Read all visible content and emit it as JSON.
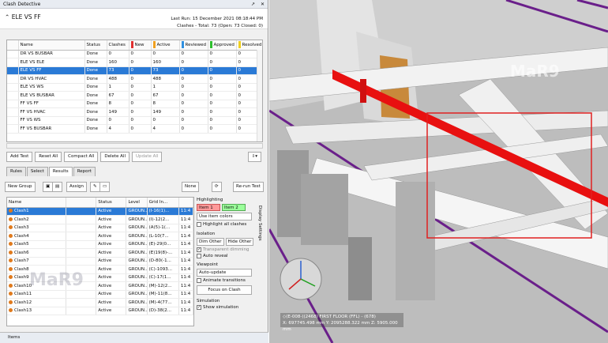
{
  "window": {
    "title": "Clash Detective",
    "buttons": [
      "↗",
      "✕"
    ]
  },
  "test_header": {
    "name": "ELE VS FF",
    "last_run": "Last Run:  15 December 2021 08:18:44 PM",
    "summary": "Clashes - Total: 73  (Open: 73  Closed: 0)"
  },
  "tests_table": {
    "headers": [
      "Name",
      "Status",
      "Clashes",
      "New",
      "Active",
      "Reviewed",
      "Approved",
      "Resolved"
    ],
    "header_colors": [
      "",
      "",
      "",
      "#e03030",
      "#f0a020",
      "#3090e0",
      "#30c030",
      "#f0d020"
    ],
    "rows": [
      [
        "DR VS BUSBAR",
        "Done",
        "0",
        "0",
        "0",
        "0",
        "0",
        "0"
      ],
      [
        "ELE VS ELE",
        "Done",
        "160",
        "0",
        "160",
        "0",
        "0",
        "0"
      ],
      [
        "ELE VS FF",
        "Done",
        "73",
        "0",
        "73",
        "0",
        "0",
        "0"
      ],
      [
        "DR VS HVAC",
        "Done",
        "488",
        "0",
        "488",
        "0",
        "0",
        "0"
      ],
      [
        "ELE VS WS",
        "Done",
        "1",
        "0",
        "1",
        "0",
        "0",
        "0"
      ],
      [
        "ELE VS BUSBAR",
        "Done",
        "67",
        "0",
        "67",
        "0",
        "0",
        "0"
      ],
      [
        "FF VS FF",
        "Done",
        "8",
        "0",
        "8",
        "0",
        "0",
        "0"
      ],
      [
        "FF VS HVAC",
        "Done",
        "149",
        "0",
        "149",
        "0",
        "0",
        "0"
      ],
      [
        "FF VS WS",
        "Done",
        "0",
        "0",
        "0",
        "0",
        "0",
        "0"
      ],
      [
        "FF VS BUSBAR",
        "Done",
        "4",
        "0",
        "4",
        "0",
        "0",
        "0"
      ]
    ],
    "selected_index": 2
  },
  "test_buttons": [
    "Add Test",
    "Reset All",
    "Compact All",
    "Delete All",
    "Update All"
  ],
  "tabs": [
    "Rules",
    "Select",
    "Results",
    "Report"
  ],
  "active_tab": 2,
  "results_toolbar": {
    "new_group": "New Group",
    "assign": "Assign",
    "none_label": "None",
    "rerun": "Re-run Test"
  },
  "results_table": {
    "headers": [
      "Name",
      "",
      "Status",
      "Level",
      "Grid In..."
    ],
    "rows": [
      [
        "Clash1",
        "Active",
        "GROUN...",
        "(I-16(1)...",
        "11:4"
      ],
      [
        "Clash2",
        "Active",
        "GROUN...",
        "(I)-12(2...",
        "11:4"
      ],
      [
        "Clash3",
        "Active",
        "GROUN...",
        "(A(5)-1(...",
        "11:4"
      ],
      [
        "Clash4",
        "Active",
        "GROUN...",
        "(L-10(7...",
        "11:4"
      ],
      [
        "Clash5",
        "Active",
        "GROUN...",
        "(E)-29(0...",
        "11:4"
      ],
      [
        "Clash6",
        "Active",
        "GROUN...",
        "(E)19(8)-...",
        "11:4"
      ],
      [
        "Clash7",
        "Active",
        "GROUN...",
        "(D-80(-1...",
        "11:4"
      ],
      [
        "Clash8",
        "Active",
        "GROUN...",
        "(C)-1093...",
        "11:4"
      ],
      [
        "Clash9",
        "Active",
        "GROUN...",
        "(C)-17(1...",
        "11:4"
      ],
      [
        "Clash10",
        "Active",
        "GROUN...",
        "(M)-12(2...",
        "11:4"
      ],
      [
        "Clash11",
        "Active",
        "GROUN...",
        "(M)-11(8...",
        "11:4"
      ],
      [
        "Clash12",
        "Active",
        "GROUN...",
        "(M)-4(77...",
        "11:4"
      ],
      [
        "Clash13",
        "Active",
        "GROUN...",
        "(D)-38(2...",
        "11:4"
      ]
    ],
    "selected_index": 0
  },
  "highlighting": {
    "title": "Highlighting",
    "item1": "Item 1",
    "item2": "Item 2",
    "use_item_colors": "Use item colors",
    "highlight_all": "Highlight all clashes",
    "isolation": "Isolation",
    "dim_other": "Dim Other",
    "hide_other": "Hide Other",
    "transparent_dimming": "Transparent dimming",
    "auto_reveal": "Auto reveal",
    "viewpoint": "Viewpoint",
    "auto_update": "Auto-update",
    "animate_transitions": "Animate transitions",
    "focus": "Focus on Clash",
    "simulation": "Simulation",
    "show_simulation": "Show simulation"
  },
  "display_settings_label": "Display Settings",
  "status_bar": {
    "label": "Items"
  },
  "viewport": {
    "watermark": "MaR9",
    "info_line1": "◇(E-008-)(2468)   FIRST FLOOR (FFL) - (678)",
    "info_line2": "X: 697745.498 mm  Y: 2095288.322 mm  Z: 5905.000 mm"
  },
  "panel_watermark": "MaR9"
}
